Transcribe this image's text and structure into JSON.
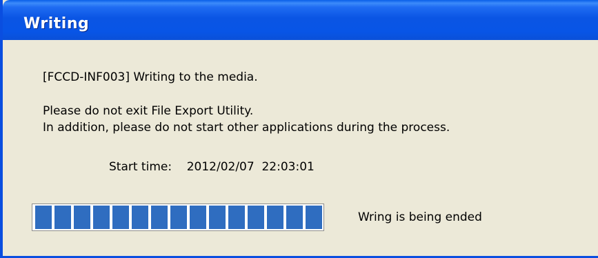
{
  "window": {
    "title": "Writing"
  },
  "message": {
    "info": "[FCCD-INF003] Writing to the media.",
    "warning_line1": "Please do not exit File Export Utility.",
    "warning_line2": "In addition, please do not start other applications during the process.",
    "start_time_label": "Start time:",
    "start_time_value": "2012/02/07  22:03:01"
  },
  "progress": {
    "fraction": 1.0,
    "status": "Wring is being ended",
    "bar_color": "#2f6dc0"
  },
  "colors": {
    "titlebar": "#0a55e4",
    "window_bg": "#ece9d8"
  }
}
